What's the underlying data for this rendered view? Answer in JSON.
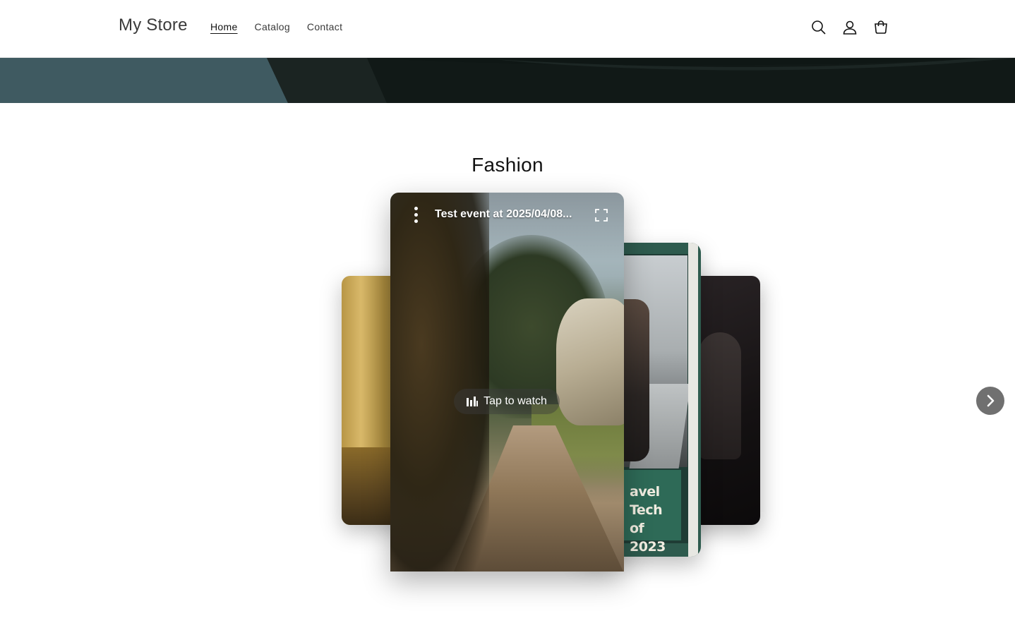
{
  "header": {
    "logo": "My Store",
    "nav": [
      {
        "label": "Home",
        "active": true
      },
      {
        "label": "Catalog",
        "active": false
      },
      {
        "label": "Contact",
        "active": false
      }
    ],
    "icons": [
      "search-icon",
      "account-icon",
      "cart-icon"
    ]
  },
  "section": {
    "title": "Fashion"
  },
  "carousel": {
    "main_card": {
      "title": "Test event at 2025/04/08...",
      "cta": "Tap to watch"
    },
    "side_card": {
      "banner_line1": "avel Tech",
      "banner_line2": "of 2023"
    }
  },
  "colors": {
    "hero_teal": "#3f5a61",
    "hero_dark": "#0f1715",
    "next_button": "#707070",
    "banner_green": "#2e6a57"
  }
}
